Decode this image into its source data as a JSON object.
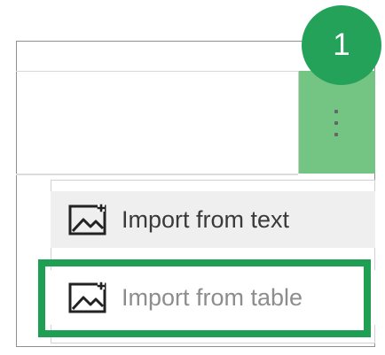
{
  "colors": {
    "accent_green": "#25a25a",
    "highlight_green": "#1f9f53",
    "selected_button_green": "#74c483",
    "menu_hover_gray": "#efefef",
    "disabled_text": "#8d8d8d"
  },
  "annotation": {
    "step_number": "1"
  },
  "toolbar": {
    "more_button_icon": "vertical-ellipsis-icon"
  },
  "menu": {
    "items": [
      {
        "icon": "image-icon",
        "label": "Import from text"
      },
      {
        "icon": "image-icon",
        "label": "Import from table"
      }
    ]
  }
}
